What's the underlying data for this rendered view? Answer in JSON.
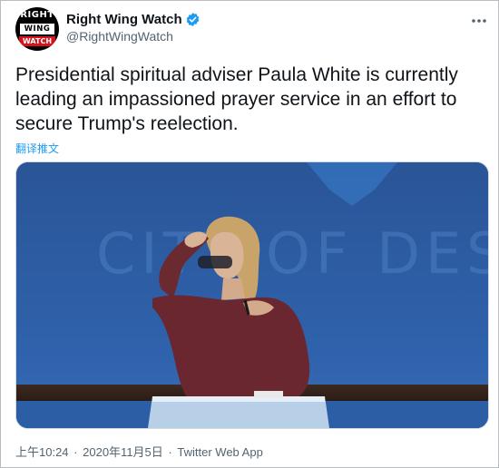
{
  "account": {
    "display_name": "Right Wing Watch",
    "handle": "@RightWingWatch",
    "avatar_text": {
      "line1": "RIGHT",
      "line2": "WING",
      "line3": "WATCH"
    }
  },
  "tweet": {
    "text": "Presidential spiritual adviser Paula White is currently leading an impassioned prayer service in an effort to secure Trump's reelection.",
    "translate_label": "翻译推文",
    "media": {
      "backdrop_text": "CITY OF DEST"
    }
  },
  "meta": {
    "time": "上午10:24",
    "separator": "·",
    "date": "2020年11月5日",
    "source": "Twitter Web App"
  },
  "colors": {
    "accent": "#1d9bf0",
    "text": "#0f1419",
    "secondary": "#536471",
    "avatar_red": "#d3141c"
  },
  "icons": {
    "verified": "verified-badge-icon",
    "more": "more-options-icon",
    "video": "video-thumbnail"
  }
}
